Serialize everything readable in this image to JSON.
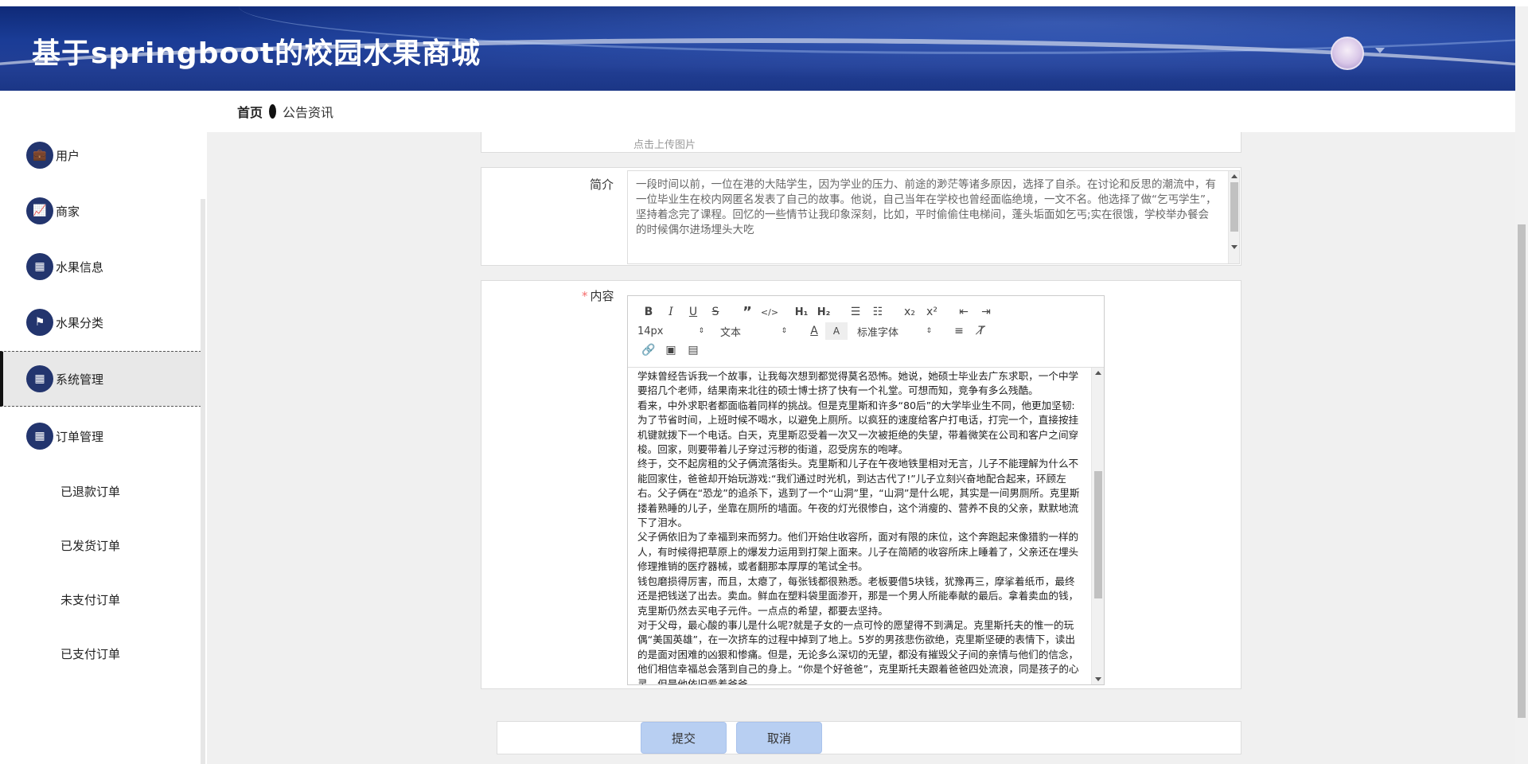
{
  "header": {
    "title": "基于springboot的校园水果商城"
  },
  "breadcrumb": {
    "home": "首页",
    "current": "公告资讯"
  },
  "sidebar": {
    "items": [
      {
        "label": "用户",
        "icon": "briefcase-icon",
        "glyph": "💼"
      },
      {
        "label": "商家",
        "icon": "chart-icon",
        "glyph": "📈"
      },
      {
        "label": "水果信息",
        "icon": "grid-icon",
        "glyph": "▦"
      },
      {
        "label": "水果分类",
        "icon": "flag-icon",
        "glyph": "⚑"
      },
      {
        "label": "系统管理",
        "icon": "grid-icon",
        "glyph": "▦"
      },
      {
        "label": "订单管理",
        "icon": "grid-icon",
        "glyph": "▦"
      }
    ],
    "sub_items": [
      "已退款订单",
      "已发货订单",
      "未支付订单",
      "已支付订单"
    ]
  },
  "form": {
    "upload_hint": "点击上传图片",
    "summary_label": "简介",
    "summary_text": "一段时间以前，一位在港的大陆学生，因为学业的压力、前途的渺茫等诸多原因，选择了自杀。在讨论和反思的潮流中，有一位毕业生在校内网匿名发表了自己的故事。他说，自己当年在学校也曾经面临绝境，一文不名。他选择了做“乞丐学生”，坚持着念完了课程。回忆的一些情节让我印象深刻，比如，平时偷偷住电梯间，蓬头垢面如乞丐;实在很饿，学校举办餐会的时候偶尔进场埋头大吃",
    "content_label": "内容",
    "content_text": [
      "学妹曾经告诉我一个故事，让我每次想到都觉得莫名恐怖。她说，她硕士毕业去广东求职，一个中学要招几个老师，结果南来北往的硕士博士挤了快有一个礼堂。可想而知，竞争有多么残酷。",
      "看来，中外求职者都面临着同样的挑战。但是克里斯和许多“80后”的大学毕业生不同，他更加坚韧:为了节省时间，上班时候不喝水，以避免上厕所。以疯狂的速度给客户打电话，打完一个，直接按挂机键就拨下一个电话。白天，克里斯忍受着一次又一次被拒绝的失望，带着微笑在公司和客户之间穿梭。回家，则要带着儿子穿过污秽的街道，忍受房东的咆哮。",
      "终于，交不起房租的父子俩流落街头。克里斯和儿子在午夜地铁里相对无言，儿子不能理解为什么不能回家住，爸爸却开始玩游戏:“我们通过时光机，到达古代了!”儿子立刻兴奋地配合起来，环顾左右。父子俩在“恐龙”的追杀下，逃到了一个“山洞”里，“山洞”是什么呢，其实是一间男厕所。克里斯搂着熟睡的儿子，坐靠在厕所的墙面。午夜的灯光很惨白，这个消瘦的、营养不良的父亲，默默地流下了泪水。",
      "父子俩依旧为了幸福到来而努力。他们开始住收容所，面对有限的床位，这个奔跑起来像猎豹一样的人，有时候得把草原上的爆发力运用到打架上面来。儿子在简陋的收容所床上睡着了，父亲还在埋头修理推销的医疗器械，或者翻那本厚厚的笔试全书。",
      "钱包磨损得厉害，而且，太瘪了，每张钱都很熟悉。老板要借5块钱，犹豫再三，摩挲着纸币，最终还是把钱送了出去。卖血。鲜血在塑料袋里面渗开，那是一个男人所能奉献的最后。拿着卖血的钱，克里斯仍然去买电子元件。一点点的希望，都要去坚持。",
      "对于父母，最心酸的事儿是什么呢?就是子女的一点可怜的愿望得不到满足。克里斯托夫的惟一的玩偶“美国英雄”，在一次挤车的过程中掉到了地上。5岁的男孩悲伤欲绝，克里斯坚硬的表情下，读出的是面对困难的凶狠和惨痛。但是，无论多么深切的无望，都没有摧毁父子间的亲情与他们的信念，他们相信幸福总会落到自己的身上。“你是个好爸爸”，克里斯托夫跟着爸爸四处流浪，同是孩子的心灵，但是他依旧爱着爸爸。"
    ],
    "submit_label": "提交",
    "cancel_label": "取消"
  },
  "editor": {
    "font_size": "14px",
    "block_format": "文本",
    "font_family": "标准字体"
  },
  "colors": {
    "header_bg": "#1a3c96",
    "menu_icon_bg": "#23356e",
    "button_bg": "#b8cff2",
    "required": "#f56c6c"
  }
}
